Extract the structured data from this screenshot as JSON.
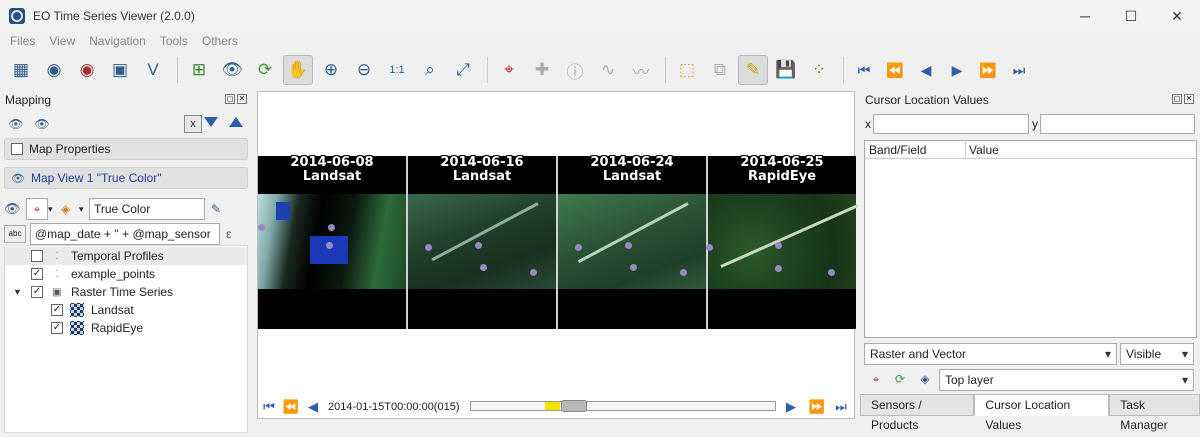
{
  "window": {
    "title": "EO Time Series Viewer (2.0.0)",
    "minimize": "─",
    "maximize": "☐",
    "close": "✕"
  },
  "menu": [
    "Files",
    "View",
    "Navigation",
    "Tools",
    "Others"
  ],
  "toolbar": {
    "icons": [
      "add-raster-icon",
      "add-vector-icon",
      "remove-raster-icon",
      "save-icon",
      "create-vector-icon",
      "zoom-full-icon",
      "show-icon",
      "refresh-icon",
      "pan-hand-icon",
      "zoom-in-icon",
      "zoom-out-icon",
      "zoom-1to1-icon",
      "zoom-pixel-icon",
      "zoom-extent-icon",
      "cursor-location-icon",
      "crosshair-icon",
      "info-icon",
      "spectral-profile-icon",
      "temporal-profile-icon",
      "select-feature-icon",
      "deselect-icon",
      "edit-pencil-icon",
      "save-edits-icon",
      "add-points-icon",
      "first-date-icon",
      "fast-back-icon",
      "previous-date-icon",
      "next-date-icon",
      "fast-forward-icon",
      "last-date-icon"
    ]
  },
  "mapping": {
    "title": "Mapping",
    "x_button": "x",
    "map_properties": "Map Properties",
    "map_view": "Map View 1 \"True Color\"",
    "render_style": "True Color",
    "label_expression": "@map_date + '' + @map_sensor",
    "layers": [
      {
        "label": "Temporal Profiles",
        "checked": false
      },
      {
        "label": "example_points",
        "checked": true
      },
      {
        "label": "Raster Time Series",
        "checked": true
      },
      {
        "label": "Landsat",
        "checked": true
      },
      {
        "label": "RapidEye",
        "checked": true
      }
    ]
  },
  "maps": [
    {
      "date": "2014-06-08",
      "sensor": "Landsat"
    },
    {
      "date": "2014-06-16",
      "sensor": "Landsat"
    },
    {
      "date": "2014-06-24",
      "sensor": "Landsat"
    },
    {
      "date": "2014-06-25",
      "sensor": "RapidEye"
    }
  ],
  "timeline": {
    "label": "2014-01-15T00:00:00(015)",
    "position_fraction": 0.3
  },
  "cursor_values": {
    "title": "Cursor Location Values",
    "x_label": "x",
    "y_label": "y",
    "x_value": "",
    "y_value": "",
    "col_band": "Band/Field",
    "col_value": "Value",
    "source_mode": "Raster and Vector",
    "visibility": "Visible",
    "layer_mode": "Top layer"
  },
  "tabs": [
    "Sensors / Products",
    "Cursor Location Values",
    "Task Manager"
  ],
  "selected_tab": 1
}
